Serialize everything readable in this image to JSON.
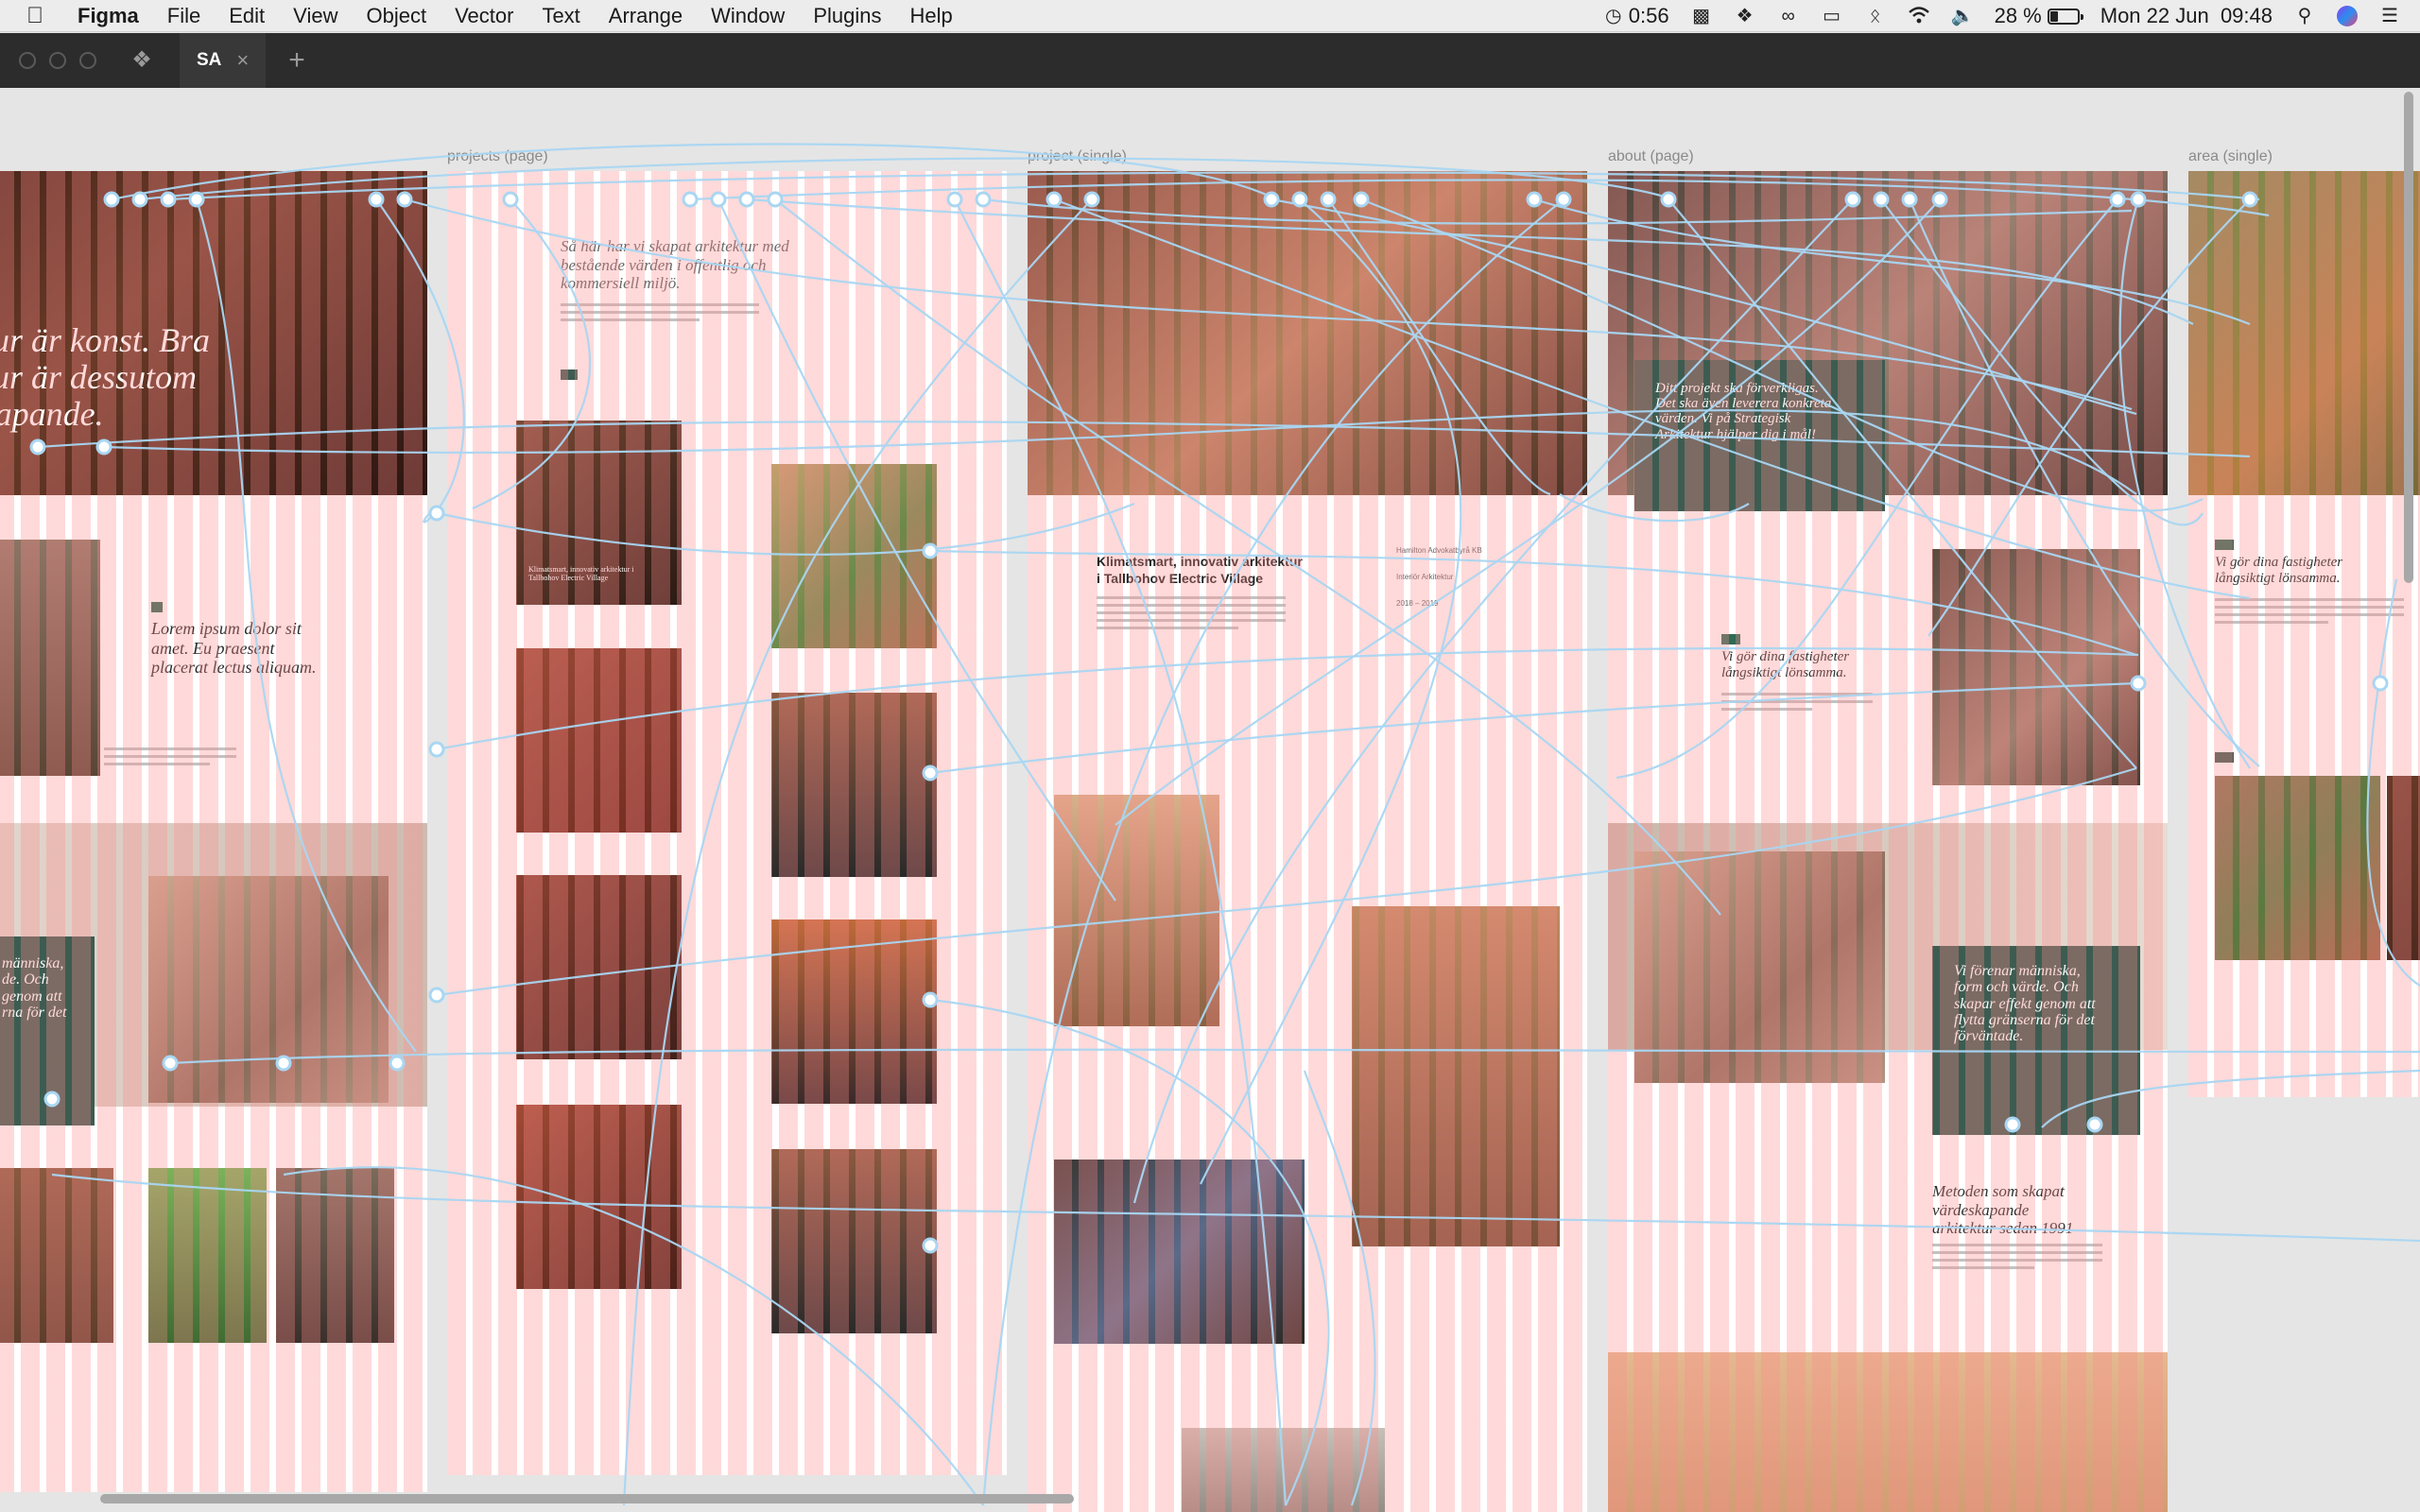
{
  "menubar": {
    "app": "Figma",
    "menus": [
      "File",
      "Edit",
      "View",
      "Object",
      "Vector",
      "Text",
      "Arrange",
      "Window",
      "Plugins",
      "Help"
    ],
    "timer": "0:56",
    "battery_text": "28 %",
    "battery_level": 0.28,
    "clock": "Mon 22 Jun  09:48",
    "icons": [
      "apple-icon",
      "timer-icon",
      "vpn-icon",
      "dropbox-icon",
      "creative-cloud-icon",
      "airplay-icon",
      "bluetooth-icon",
      "wifi-icon",
      "volume-icon",
      "battery-icon",
      "spotlight-icon",
      "siri-icon",
      "control-center-icon"
    ]
  },
  "titlebar": {
    "tab_label": "SA",
    "close_glyph": "×",
    "new_tab_glyph": "+"
  },
  "frames": [
    {
      "label": ""
    },
    {
      "label": "projects (page)"
    },
    {
      "label": "project (single)"
    },
    {
      "label": "about (page)"
    },
    {
      "label": "area (single)"
    }
  ],
  "content": {
    "home_hero": "rkitektur är konst. Bra\nrkitektur är dessutom\närdeskapande.",
    "home_block": "Lorem ipsum dolor sit\namet. Eu praesent\nplacerat lectus aliquam.",
    "home_green": "människa,\nde. Och\ngenom att\nrna för det",
    "projects_intro": "Så här har vi skapat arkitektur med\nbestående värden i offentlig och\nkommersiell miljö.",
    "projects_card": "Klimatsmart, innovativ arkitektur i\nTallbohov Electric Village",
    "project_title": "Klimatsmart, innovativ arkitektur\ni Tallbohov Electric Village",
    "project_client": "Hamilton Advokatbyrå KB",
    "project_service": "Interiör Arkitektur",
    "project_years": "2018 – 2019",
    "about_green": "Ditt projekt ska förverkligas.\nDet ska även leverera konkreta\nvärden. Vi på Strategisk\nArkitektur hjälper dig i mål!",
    "about_heading": "Vi gör dina fastigheter\nlångsiktigt lönsamma.",
    "about_green2": "Vi förenar människa,\nform och värde. Och\nskapar effekt genom att\nflytta gränserna för det\nförväntade.",
    "about_method": "Metoden som skapat\nvärdeskapande\narkitektur sedan 1991",
    "area_heading": "Vi gör dina fastigheter\nlångsiktigt lönsamma."
  }
}
